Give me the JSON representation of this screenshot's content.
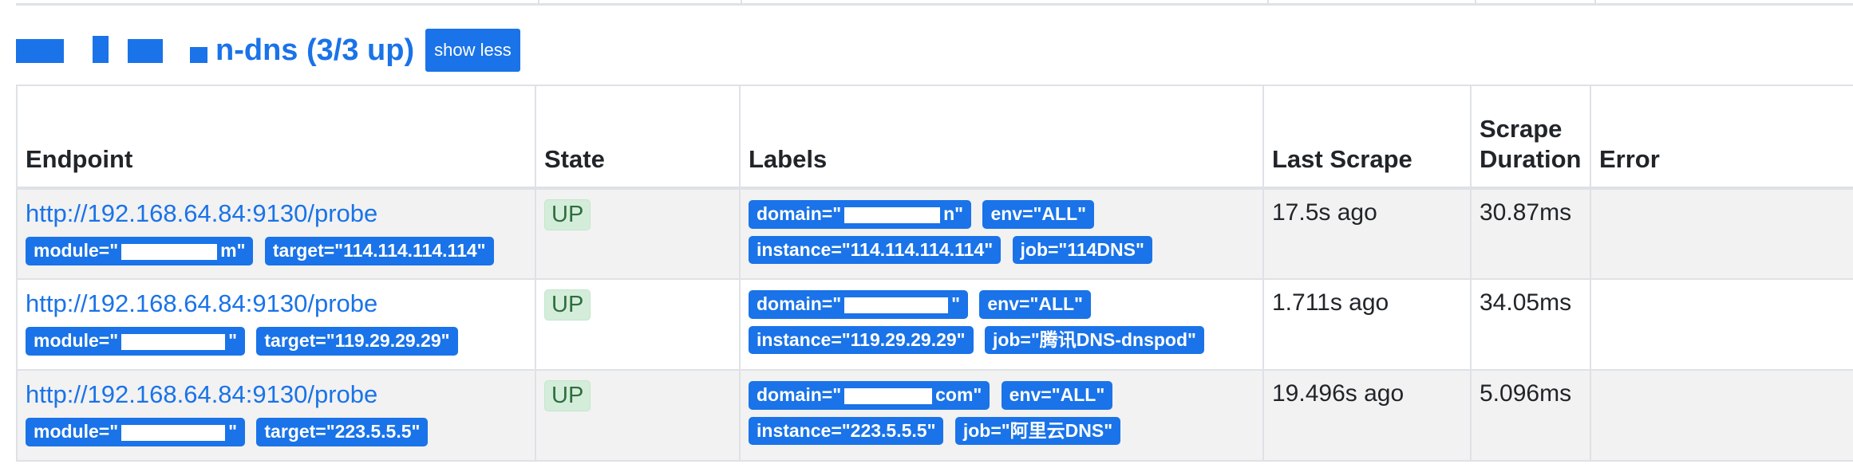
{
  "group": {
    "title_visible": "n-dns (3/3 up)",
    "toggle_label": "show less"
  },
  "table": {
    "headers": [
      "Endpoint",
      "State",
      "Labels",
      "Last Scrape",
      "Scrape Duration",
      "Error"
    ],
    "rows": [
      {
        "endpoint": "http://192.168.64.84:9130/probe",
        "module_prefix": "module=\"",
        "module_suffix": "m\"",
        "target": "target=\"114.114.114.114\"",
        "state": "UP",
        "domain_prefix": "domain=\"",
        "domain_suffix": "n\"",
        "env": "env=\"ALL\"",
        "instance": "instance=\"114.114.114.114\"",
        "job": "job=\"114DNS\"",
        "last_scrape": "17.5s ago",
        "duration": "30.87ms",
        "error": ""
      },
      {
        "endpoint": "http://192.168.64.84:9130/probe",
        "module_prefix": "module=\"",
        "module_suffix": "\"",
        "target": "target=\"119.29.29.29\"",
        "state": "UP",
        "domain_prefix": "domain=\"",
        "domain_suffix": "\"",
        "env": "env=\"ALL\"",
        "instance": "instance=\"119.29.29.29\"",
        "job": "job=\"腾讯DNS-dnspod\"",
        "last_scrape": "1.711s ago",
        "duration": "34.05ms",
        "error": ""
      },
      {
        "endpoint": "http://192.168.64.84:9130/probe",
        "module_prefix": "module=\"",
        "module_suffix": "\"",
        "target": "target=\"223.5.5.5\"",
        "state": "UP",
        "domain_prefix": "domain=\"",
        "domain_suffix": "com\"",
        "env": "env=\"ALL\"",
        "instance": "instance=\"223.5.5.5\"",
        "job": "job=\"阿里云DNS\"",
        "last_scrape": "19.496s ago",
        "duration": "5.096ms",
        "error": ""
      }
    ]
  },
  "colors": {
    "accent": "#1a73e8",
    "up_bg": "#d4edda",
    "up_text": "#2f6f3e",
    "border": "#dee2e6",
    "stripe": "#f2f2f2"
  }
}
